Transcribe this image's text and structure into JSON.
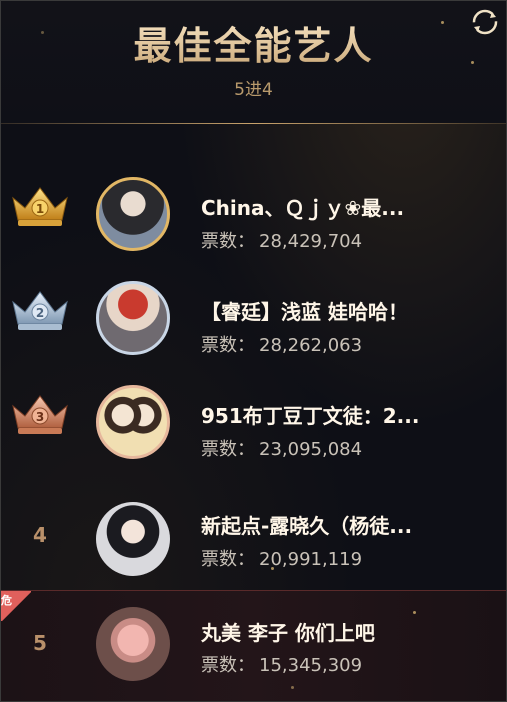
{
  "header": {
    "title": "最佳全能艺人",
    "subtitle": "5进4"
  },
  "icons": {
    "refresh": "refresh-icon",
    "crown": "crown-icon"
  },
  "colors": {
    "gold": "#e4b24a",
    "silver": "#9fb6cc",
    "bronze": "#d58a6a",
    "highlight_tag": "#e0605c"
  },
  "vote_label": "票数：",
  "entries": [
    {
      "rank": "1",
      "name": "China、Ｑｊｙ❀最...",
      "votes": "28,429,704",
      "crown": "gold"
    },
    {
      "rank": "2",
      "name": "【睿廷】浅蓝 娃哈哈！",
      "votes": "28,262,063",
      "crown": "silver"
    },
    {
      "rank": "3",
      "name": "951布丁豆丁文徒：2...",
      "votes": "23,095,084",
      "crown": "bronze"
    },
    {
      "rank": "4",
      "name": "新起点-露晓久（杨徒...",
      "votes": "20,991,119"
    },
    {
      "rank": "5",
      "name": "丸美 李子 你们上吧",
      "votes": "15,345,309",
      "tag": "危"
    }
  ]
}
